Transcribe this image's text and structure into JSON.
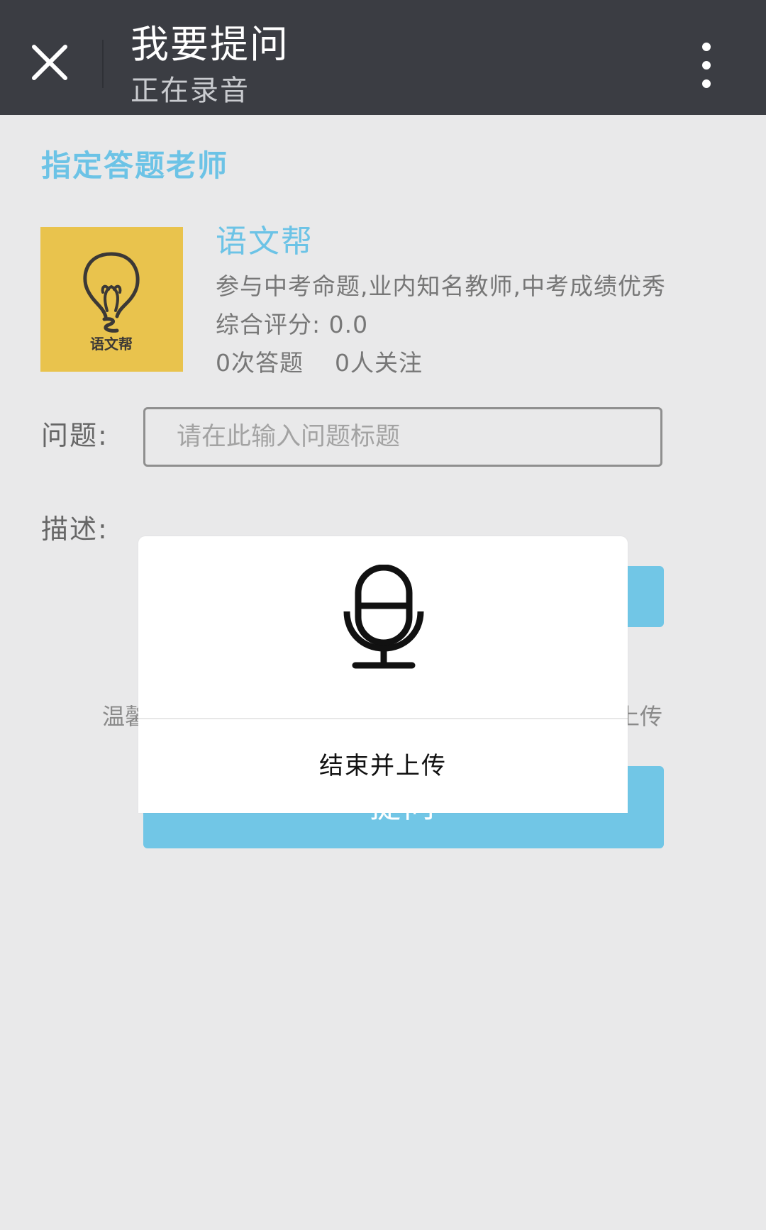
{
  "header": {
    "title": "我要提问",
    "subtitle": "正在录音",
    "close_icon": "close-icon",
    "more_icon": "more-vertical-icon",
    "background": "#3b3d43"
  },
  "section": {
    "title": "指定答题老师"
  },
  "teacher": {
    "name": "语文帮",
    "avatar_text": "语文帮",
    "description": "参与中考命题,业内知名教师,中考成绩优秀",
    "rating": "综合评分: 0.0",
    "answers": "0次答题",
    "followers": "0人关注"
  },
  "form": {
    "question_label": "问题:",
    "question_placeholder": "请在此输入问题标题",
    "question_value": "",
    "description_label": "描述:"
  },
  "tip": {
    "left_text": "温馨",
    "right_text": "上传"
  },
  "submit": {
    "label": "提问"
  },
  "recording_popup": {
    "icon": "microphone-icon",
    "action_label": "结束并上传"
  },
  "colors": {
    "accent": "#6cc3e6",
    "button": "#71c6e6",
    "page_bg": "#e9e9ea",
    "avatar_bg": "#e9c34d"
  }
}
